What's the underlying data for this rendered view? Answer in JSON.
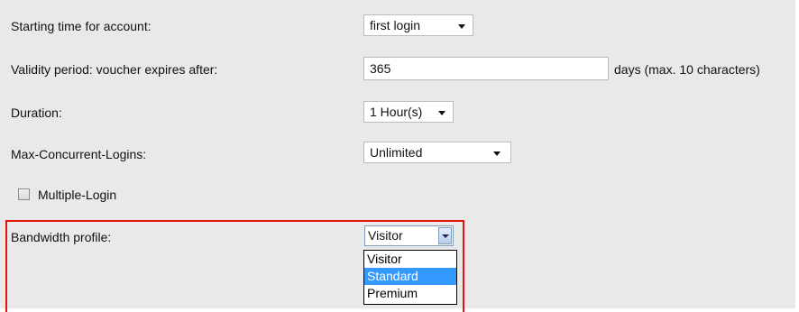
{
  "form": {
    "start_time": {
      "label": "Starting time for account:",
      "value": "first login"
    },
    "validity": {
      "label": "Validity period: voucher expires after:",
      "value": "365",
      "unit_hint": "days (max. 10 characters)"
    },
    "duration": {
      "label": "Duration:",
      "value": "1 Hour(s)"
    },
    "max_logins": {
      "label": "Max-Concurrent-Logins:",
      "value": "Unlimited"
    },
    "multiple_login": {
      "label": "Multiple-Login",
      "checked": false
    },
    "bandwidth": {
      "label": "Bandwidth profile:",
      "value": "Visitor",
      "options": [
        "Visitor",
        "Standard",
        "Premium"
      ],
      "highlighted_option": "Standard"
    }
  },
  "colors": {
    "highlight_border": "#e8120c",
    "selected_option_bg": "#3399ff",
    "panel_bg": "#e9e9e9"
  }
}
